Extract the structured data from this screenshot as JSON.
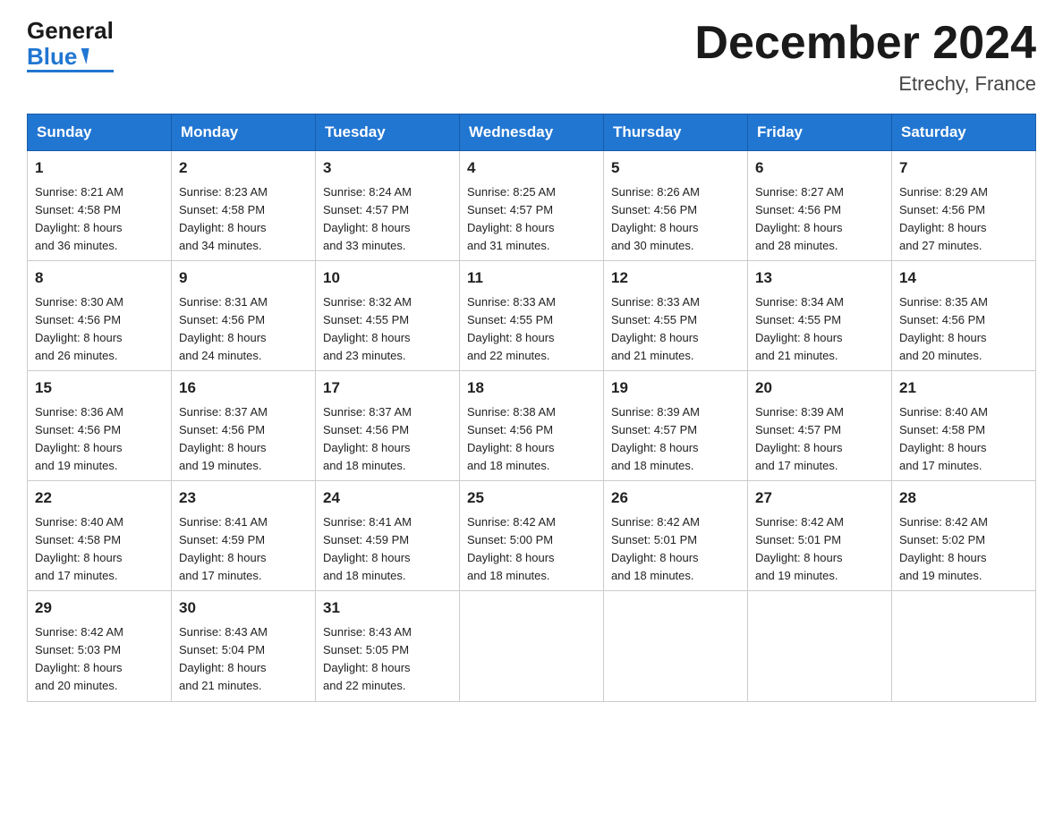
{
  "header": {
    "title": "December 2024",
    "subtitle": "Etrechy, France",
    "logo_general": "General",
    "logo_blue": "Blue"
  },
  "days_of_week": [
    "Sunday",
    "Monday",
    "Tuesday",
    "Wednesday",
    "Thursday",
    "Friday",
    "Saturday"
  ],
  "weeks": [
    [
      {
        "day": "1",
        "sunrise": "8:21 AM",
        "sunset": "4:58 PM",
        "daylight": "8 hours and 36 minutes."
      },
      {
        "day": "2",
        "sunrise": "8:23 AM",
        "sunset": "4:58 PM",
        "daylight": "8 hours and 34 minutes."
      },
      {
        "day": "3",
        "sunrise": "8:24 AM",
        "sunset": "4:57 PM",
        "daylight": "8 hours and 33 minutes."
      },
      {
        "day": "4",
        "sunrise": "8:25 AM",
        "sunset": "4:57 PM",
        "daylight": "8 hours and 31 minutes."
      },
      {
        "day": "5",
        "sunrise": "8:26 AM",
        "sunset": "4:56 PM",
        "daylight": "8 hours and 30 minutes."
      },
      {
        "day": "6",
        "sunrise": "8:27 AM",
        "sunset": "4:56 PM",
        "daylight": "8 hours and 28 minutes."
      },
      {
        "day": "7",
        "sunrise": "8:29 AM",
        "sunset": "4:56 PM",
        "daylight": "8 hours and 27 minutes."
      }
    ],
    [
      {
        "day": "8",
        "sunrise": "8:30 AM",
        "sunset": "4:56 PM",
        "daylight": "8 hours and 26 minutes."
      },
      {
        "day": "9",
        "sunrise": "8:31 AM",
        "sunset": "4:56 PM",
        "daylight": "8 hours and 24 minutes."
      },
      {
        "day": "10",
        "sunrise": "8:32 AM",
        "sunset": "4:55 PM",
        "daylight": "8 hours and 23 minutes."
      },
      {
        "day": "11",
        "sunrise": "8:33 AM",
        "sunset": "4:55 PM",
        "daylight": "8 hours and 22 minutes."
      },
      {
        "day": "12",
        "sunrise": "8:33 AM",
        "sunset": "4:55 PM",
        "daylight": "8 hours and 21 minutes."
      },
      {
        "day": "13",
        "sunrise": "8:34 AM",
        "sunset": "4:55 PM",
        "daylight": "8 hours and 21 minutes."
      },
      {
        "day": "14",
        "sunrise": "8:35 AM",
        "sunset": "4:56 PM",
        "daylight": "8 hours and 20 minutes."
      }
    ],
    [
      {
        "day": "15",
        "sunrise": "8:36 AM",
        "sunset": "4:56 PM",
        "daylight": "8 hours and 19 minutes."
      },
      {
        "day": "16",
        "sunrise": "8:37 AM",
        "sunset": "4:56 PM",
        "daylight": "8 hours and 19 minutes."
      },
      {
        "day": "17",
        "sunrise": "8:37 AM",
        "sunset": "4:56 PM",
        "daylight": "8 hours and 18 minutes."
      },
      {
        "day": "18",
        "sunrise": "8:38 AM",
        "sunset": "4:56 PM",
        "daylight": "8 hours and 18 minutes."
      },
      {
        "day": "19",
        "sunrise": "8:39 AM",
        "sunset": "4:57 PM",
        "daylight": "8 hours and 18 minutes."
      },
      {
        "day": "20",
        "sunrise": "8:39 AM",
        "sunset": "4:57 PM",
        "daylight": "8 hours and 17 minutes."
      },
      {
        "day": "21",
        "sunrise": "8:40 AM",
        "sunset": "4:58 PM",
        "daylight": "8 hours and 17 minutes."
      }
    ],
    [
      {
        "day": "22",
        "sunrise": "8:40 AM",
        "sunset": "4:58 PM",
        "daylight": "8 hours and 17 minutes."
      },
      {
        "day": "23",
        "sunrise": "8:41 AM",
        "sunset": "4:59 PM",
        "daylight": "8 hours and 17 minutes."
      },
      {
        "day": "24",
        "sunrise": "8:41 AM",
        "sunset": "4:59 PM",
        "daylight": "8 hours and 18 minutes."
      },
      {
        "day": "25",
        "sunrise": "8:42 AM",
        "sunset": "5:00 PM",
        "daylight": "8 hours and 18 minutes."
      },
      {
        "day": "26",
        "sunrise": "8:42 AM",
        "sunset": "5:01 PM",
        "daylight": "8 hours and 18 minutes."
      },
      {
        "day": "27",
        "sunrise": "8:42 AM",
        "sunset": "5:01 PM",
        "daylight": "8 hours and 19 minutes."
      },
      {
        "day": "28",
        "sunrise": "8:42 AM",
        "sunset": "5:02 PM",
        "daylight": "8 hours and 19 minutes."
      }
    ],
    [
      {
        "day": "29",
        "sunrise": "8:42 AM",
        "sunset": "5:03 PM",
        "daylight": "8 hours and 20 minutes."
      },
      {
        "day": "30",
        "sunrise": "8:43 AM",
        "sunset": "5:04 PM",
        "daylight": "8 hours and 21 minutes."
      },
      {
        "day": "31",
        "sunrise": "8:43 AM",
        "sunset": "5:05 PM",
        "daylight": "8 hours and 22 minutes."
      },
      null,
      null,
      null,
      null
    ]
  ],
  "labels": {
    "sunrise": "Sunrise:",
    "sunset": "Sunset:",
    "daylight": "Daylight:"
  }
}
